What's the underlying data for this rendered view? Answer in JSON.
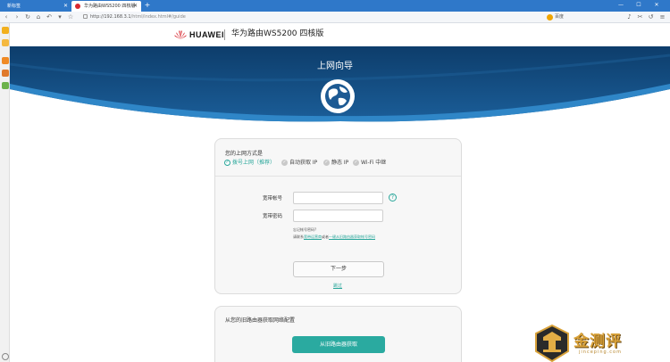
{
  "browser": {
    "tabs": [
      {
        "label": "新标签"
      },
      {
        "label": "华为路由WS5200 四核版"
      }
    ],
    "new_tab": "+",
    "url_prefix": "http://192.168.3.1",
    "url_path": "/html/index.html#/guide",
    "search_placeholder": "百度",
    "window_controls": [
      "—",
      "☐",
      "✕"
    ]
  },
  "header": {
    "brand": "HUAWEI",
    "product": "华为路由WS5200 四核版"
  },
  "banner": {
    "title": "上网向导"
  },
  "setup": {
    "section_title": "您的上网方式是",
    "modes": [
      {
        "label": "拨号上网（推荐）",
        "selected": true
      },
      {
        "label": "自动获取 IP",
        "selected": false
      },
      {
        "label": "静态 IP",
        "selected": false
      },
      {
        "label": "Wi-Fi 中继",
        "selected": false
      }
    ],
    "account_label": "宽带帐号",
    "account_value": "",
    "password_label": "宽带密码",
    "password_value": "",
    "help_glyph": "?",
    "forgot_line": "忘记帐号密码?",
    "hint_prefix": "请联系",
    "hint_link1": "宽带运营商",
    "hint_middle": "或者",
    "hint_link2": "一键从旧路由器获取帐号密码",
    "next_button": "下一步",
    "skip_link": "跳过"
  },
  "migrate": {
    "title": "从您的旧路由器获取网络配置",
    "button": "从旧路由器获取"
  },
  "watermark": {
    "text": "金测评",
    "sub": "jinceping.com"
  },
  "colors": {
    "accent": "#2aa79b",
    "tabbar": "#2f78c9",
    "banner_dark": "#0d3d6b",
    "banner_mid": "#1f6aa8",
    "huawei_red": "#d7282f"
  }
}
